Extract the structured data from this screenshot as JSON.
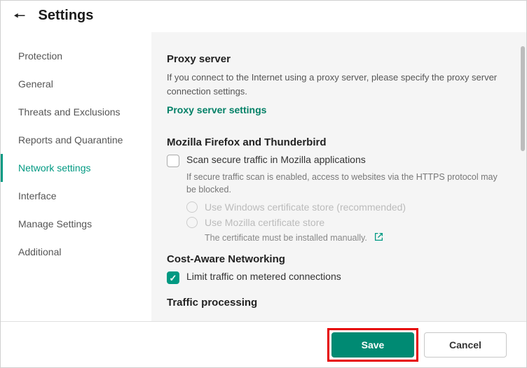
{
  "header": {
    "title": "Settings"
  },
  "sidebar": {
    "items": [
      {
        "label": "Protection"
      },
      {
        "label": "General"
      },
      {
        "label": "Threats and Exclusions"
      },
      {
        "label": "Reports and Quarantine"
      },
      {
        "label": "Network settings"
      },
      {
        "label": "Interface"
      },
      {
        "label": "Manage Settings"
      },
      {
        "label": "Additional"
      }
    ]
  },
  "content": {
    "proxy": {
      "heading": "Proxy server",
      "desc": "If you connect to the Internet using a proxy server, please specify the proxy server connection settings.",
      "link": "Proxy server settings"
    },
    "mozilla": {
      "heading": "Mozilla Firefox and Thunderbird",
      "checkbox_label": "Scan secure traffic in Mozilla applications",
      "sub_desc": "If secure traffic scan is enabled, access to websites via the HTTPS protocol may be blocked.",
      "radio1": "Use Windows certificate store (recommended)",
      "radio2": "Use Mozilla certificate store",
      "note": "The certificate must be installed manually."
    },
    "cost": {
      "heading": "Cost-Aware Networking",
      "checkbox_label": "Limit traffic on metered connections"
    },
    "traffic": {
      "heading": "Traffic processing"
    }
  },
  "footer": {
    "save": "Save",
    "cancel": "Cancel"
  }
}
